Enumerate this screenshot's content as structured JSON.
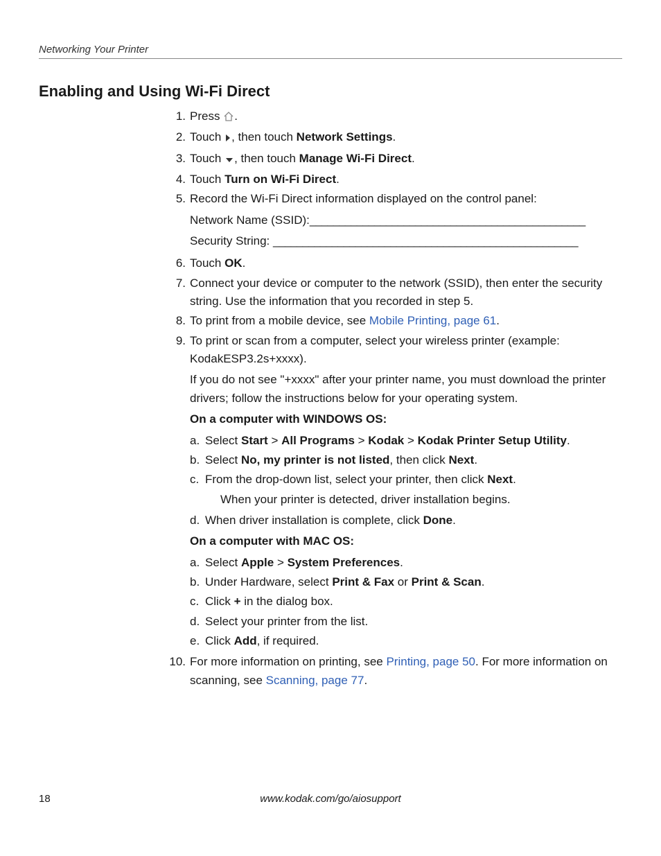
{
  "header": {
    "running": "Networking Your Printer"
  },
  "section": {
    "title": "Enabling and Using Wi-Fi Direct"
  },
  "steps": {
    "n1": "1.",
    "s1_a": "Press ",
    "s1_b": ".",
    "n2": "2.",
    "s2_a": "Touch ",
    "s2_b": ", then touch ",
    "s2_c": "Network Settings",
    "s2_d": ".",
    "n3": "3.",
    "s3_a": "Touch ",
    "s3_b": ", then touch ",
    "s3_c": "Manage Wi-Fi Direct",
    "s3_d": ".",
    "n4": "4.",
    "s4_a": "Touch ",
    "s4_b": "Turn on Wi-Fi Direct",
    "s4_c": ".",
    "n5": "5.",
    "s5_a": "Record the Wi-Fi Direct information displayed on the control panel:",
    "s5_ssid_label": "Network Name (SSID):",
    "s5_ssid_blank": "_______________________________________________",
    "s5_sec_label": "Security String: ",
    "s5_sec_blank": "____________________________________________________",
    "n6": "6.",
    "s6_a": "Touch ",
    "s6_b": "OK",
    "s6_c": ".",
    "n7": "7.",
    "s7": "Connect your device or computer to the network (SSID), then enter the security string. Use the information that you recorded in step 5.",
    "n8": "8.",
    "s8_a": "To print from a mobile device, see ",
    "s8_link": "Mobile Printing, page 61",
    "s8_b": ".",
    "n9": "9.",
    "s9_a": "To print or scan from a computer, select your wireless printer (example: KodakESP3.2s+xxxx).",
    "s9_b": "If you do not see \"+xxxx\" after your printer name, you must download the printer drivers; follow the instructions below for your operating system.",
    "win_head": "On a computer with WINDOWS OS:",
    "wa_n": "a.",
    "wa_1": "Select ",
    "wa_start": "Start",
    "wa_gt": " > ",
    "wa_all": "All Programs",
    "wa_kodak": "Kodak",
    "wa_util": "Kodak Printer Setup Utility",
    "wa_dot": ".",
    "wb_n": "b.",
    "wb_1": "Select ",
    "wb_no": "No, my printer is not listed",
    "wb_2": ", then click ",
    "wb_next": "Next",
    "wb_dot": ".",
    "wc_n": "c.",
    "wc_1": "From the drop-down list, select your printer, then click ",
    "wc_next": "Next",
    "wc_dot": ".",
    "wc_2": "When your printer is detected, driver installation begins.",
    "wd_n": "d.",
    "wd_1": "When driver installation is complete, click ",
    "wd_done": "Done",
    "wd_dot": ".",
    "mac_head": "On a computer with MAC OS:",
    "ma_n": "a.",
    "ma_1": "Select ",
    "ma_apple": "Apple",
    "ma_gt": " > ",
    "ma_sys": "System Preferences",
    "ma_dot": ".",
    "mb_n": "b.",
    "mb_1": "Under Hardware, select ",
    "mb_fax": "Print & Fax",
    "mb_or": " or ",
    "mb_scan": "Print & Scan",
    "mb_dot": ".",
    "mc_n": "c.",
    "mc_1": "Click ",
    "mc_plus": "+",
    "mc_2": " in the dialog box.",
    "md_n": "d.",
    "md_1": "Select your printer from the list.",
    "me_n": "e.",
    "me_1": "Click ",
    "me_add": "Add",
    "me_2": ", if required.",
    "n10": "10.",
    "s10_a": "For more information on printing, see ",
    "s10_link1": "Printing, page 50",
    "s10_b": ". For more information on scanning, see ",
    "s10_link2": "Scanning, page 77",
    "s10_c": "."
  },
  "footer": {
    "page": "18",
    "url": "www.kodak.com/go/aiosupport"
  }
}
